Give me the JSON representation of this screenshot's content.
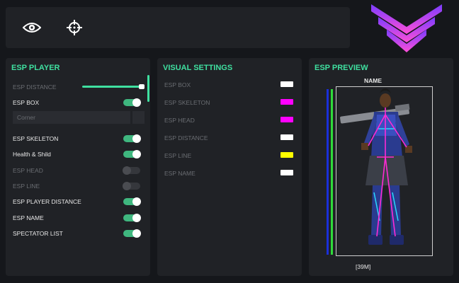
{
  "topbar": {
    "icons": [
      "eye-icon",
      "crosshair-icon"
    ]
  },
  "esp_player": {
    "title": "ESP PLAYER",
    "distance": {
      "label": "ESP DISTANCE",
      "value": 0.95
    },
    "box": {
      "label": "ESP BOX",
      "on": true
    },
    "box_style": {
      "value": "Corner"
    },
    "skeleton": {
      "label": "ESP SKELETON",
      "on": true
    },
    "health": {
      "label": "Health & Shild",
      "on": true
    },
    "head": {
      "label": "ESP HEAD",
      "on": false
    },
    "line": {
      "label": "ESP LINE",
      "on": false
    },
    "player_distance": {
      "label": "ESP PLAYER DISTANCE",
      "on": true
    },
    "name": {
      "label": "ESP NAME",
      "on": true
    },
    "spectator": {
      "label": "SPECTATOR LIST",
      "on": true
    }
  },
  "visual_settings": {
    "title": "VISUAL SETTINGS",
    "items": [
      {
        "label": "ESP BOX",
        "color": "#ffffff"
      },
      {
        "label": "ESP SKELETON",
        "color": "#ff00ff"
      },
      {
        "label": "ESP HEAD",
        "color": "#ff00ff"
      },
      {
        "label": "ESP DISTANCE",
        "color": "#ffffff"
      },
      {
        "label": "ESP LINE",
        "color": "#ffff00"
      },
      {
        "label": "ESP NAME",
        "color": "#ffffff"
      }
    ]
  },
  "preview": {
    "title": "ESP PREVIEW",
    "name": "NAME",
    "distance": "[39M]",
    "health_colors": {
      "shield": "#1a2fd9",
      "health": "#2fdc3a"
    }
  },
  "colors": {
    "accent": "#3fe0a0",
    "panel": "#202226",
    "background": "#15171b",
    "logo_gradient": [
      "#7a3cff",
      "#ff4fd8"
    ]
  }
}
